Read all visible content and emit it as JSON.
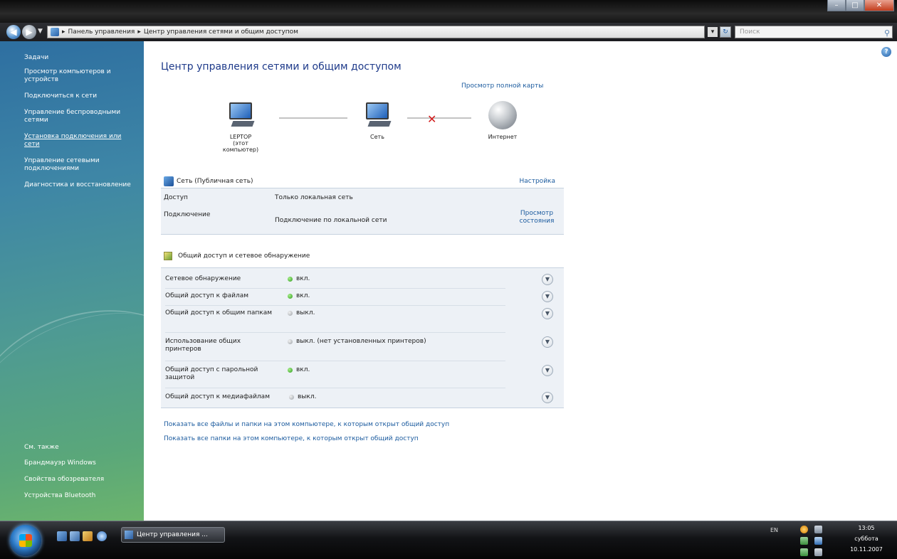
{
  "window": {
    "controls": [
      "–",
      "□",
      "✕"
    ]
  },
  "address_bar": {
    "path": [
      "Панель управления",
      "Центр управления сетями и общим доступом"
    ],
    "search_placeholder": "Поиск"
  },
  "sidebar": {
    "tasks_title": "Задачи",
    "tasks": [
      "Просмотр компьютеров и устройств",
      "Подключиться к сети",
      "Управление беспроводными сетями",
      "Установка подключения или сети",
      "Управление сетевыми подключениями",
      "Диагностика и восстановление"
    ],
    "see_also_title": "См. также",
    "see_also": [
      "Брандмауэр Windows",
      "Свойства обозревателя",
      "Устройства Bluetooth"
    ]
  },
  "main": {
    "title": "Центр управления сетями и общим доступом",
    "full_map_link": "Просмотр полной карты",
    "map": {
      "computer_name": "LEPTOP",
      "computer_sub": "(этот компьютер)",
      "network_label": "Сеть",
      "internet_label": "Интернет"
    },
    "network": {
      "name": "Сеть (Публичная сеть)",
      "settings_link": "Настройка",
      "rows": [
        {
          "label": "Доступ",
          "value": "Только локальная сеть"
        },
        {
          "label": "Подключение",
          "value": "Подключение по локальной сети"
        }
      ],
      "status_link": "Просмотр состояния"
    },
    "sharing": {
      "title": "Общий доступ и сетевое обнаружение",
      "rows": [
        {
          "label": "Сетевое обнаружение",
          "value": "вкл.",
          "on": true
        },
        {
          "label": "Общий доступ к файлам",
          "value": "вкл.",
          "on": true
        },
        {
          "label": "Общий доступ к общим папкам",
          "value": "выкл.",
          "on": false
        },
        {
          "label": "Использование общих принтеров",
          "value": "выкл. (нет установленных принтеров)",
          "on": false
        },
        {
          "label": "Общий доступ с парольной защитой",
          "value": "вкл.",
          "on": true
        },
        {
          "label": "Общий доступ к медиафайлам",
          "value": "выкл.",
          "on": false
        }
      ]
    },
    "links": [
      "Показать все файлы и папки на этом компьютере, к которым открыт общий доступ",
      "Показать все папки на этом компьютере, к которым открыт общий доступ"
    ]
  },
  "taskbar": {
    "task_button": "Центр управления ...",
    "language": "EN",
    "time": "13:05",
    "day": "суббота",
    "date": "10.11.2007"
  },
  "colors": {
    "link": "#1a5a9e",
    "title": "#1e3a8a",
    "status_on": "#2f9a1f",
    "status_off": "#9aa0a6",
    "blocked": "#d21c1c"
  },
  "icons": {
    "computer": "computer-icon",
    "network": "network-icon",
    "internet": "globe-icon",
    "broken_link": "red-x-icon",
    "sharing": "sharing-icon",
    "help": "help-icon"
  }
}
